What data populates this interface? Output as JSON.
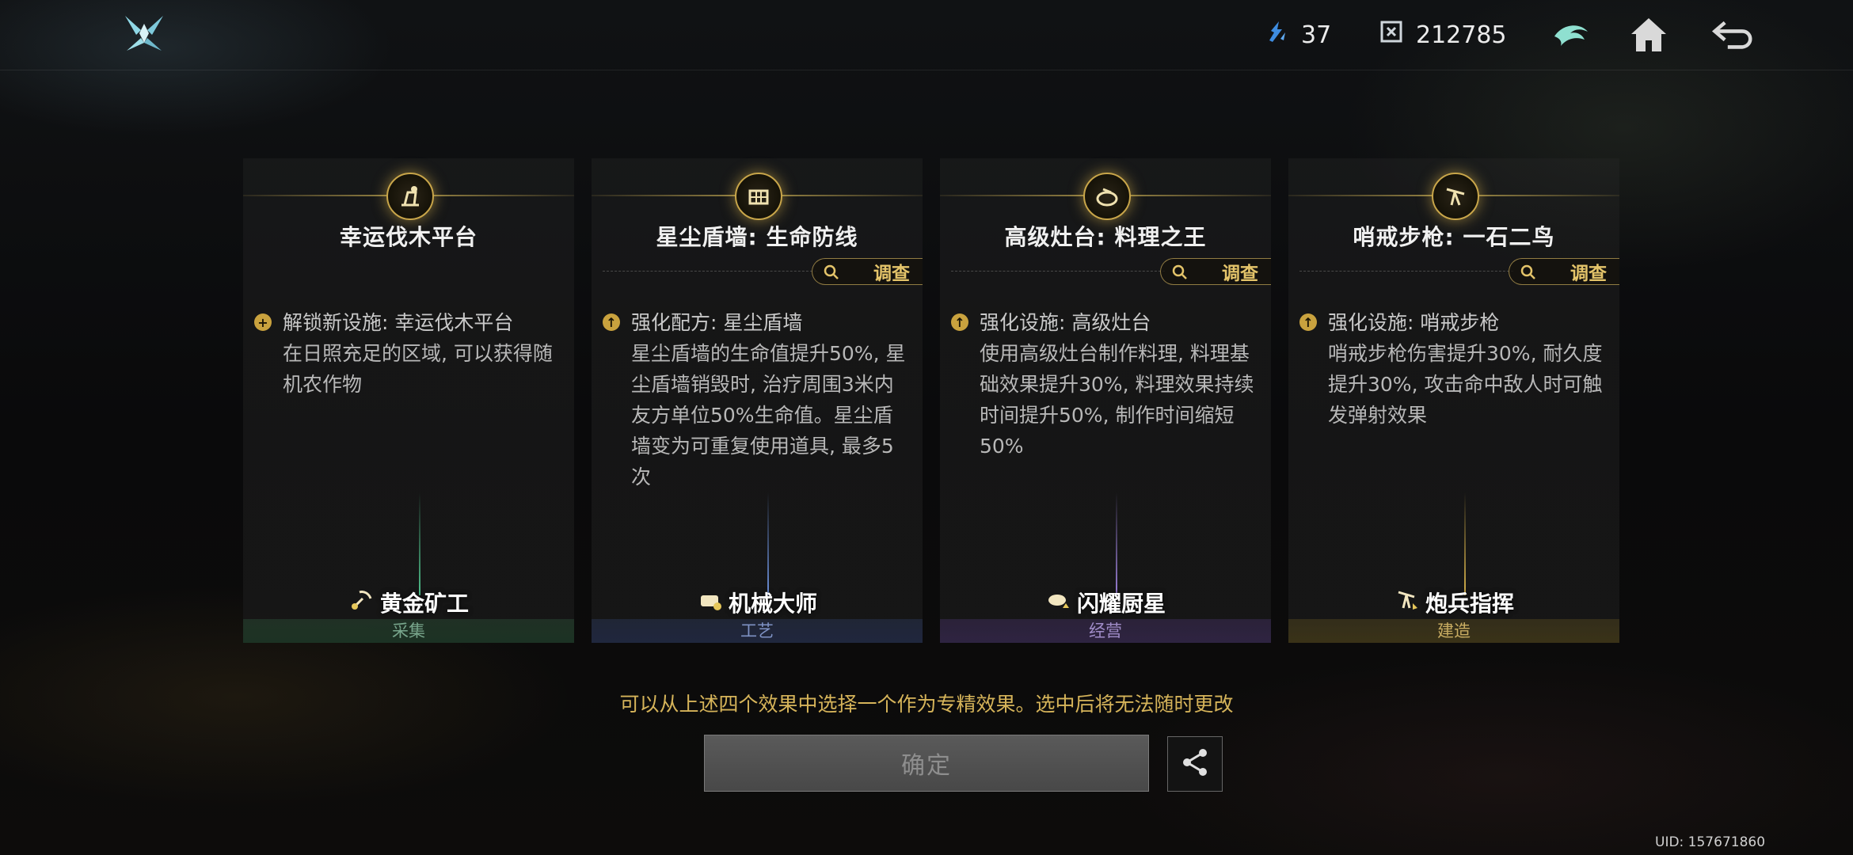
{
  "topbar": {
    "resource_a": {
      "icon": "crystal-shard-icon",
      "value": "37"
    },
    "resource_b": {
      "icon": "currency-cube-icon",
      "value": "212785"
    },
    "icons": [
      "brand-emblem-icon",
      "home-icon",
      "back-icon"
    ]
  },
  "cards": [
    {
      "emblem": "lumber-platform-icon",
      "title": "幸运伐木平台",
      "inspect_label": "",
      "effect_head": "解锁新设施: 幸运伐木平台",
      "effect_body": "在日照充足的区域, 可以获得随机农作物",
      "role": "黄金矿工",
      "role_icon": "miner-icon",
      "category": "采集",
      "accent": "#4fbf8a"
    },
    {
      "emblem": "stardust-wall-icon",
      "title": "星尘盾墙: 生命防线",
      "inspect_label": "调查",
      "effect_head": "强化配方: 星尘盾墙",
      "effect_body": "星尘盾墙的生命值提升50%, 星尘盾墙销毁时, 治疗周围3米内友方单位50%生命值。星尘盾墙变为可重复使用道具, 最多5次",
      "role": "机械大师",
      "role_icon": "mechanic-icon",
      "category": "工艺",
      "accent": "#6b8fd8"
    },
    {
      "emblem": "stove-icon",
      "title": "高级灶台: 料理之王",
      "inspect_label": "调查",
      "effect_head": "强化设施: 高级灶台",
      "effect_body": "使用高级灶台制作料理, 料理基础效果提升30%, 料理效果持续时间提升50%, 制作时间缩短50%",
      "role": "闪耀厨星",
      "role_icon": "chef-icon",
      "category": "经营",
      "accent": "#9a7fd6"
    },
    {
      "emblem": "sentry-rifle-icon",
      "title": "哨戒步枪: 一石二鸟",
      "inspect_label": "调查",
      "effect_head": "强化设施: 哨戒步枪",
      "effect_body": "哨戒步枪伤害提升30%, 耐久度提升30%, 攻击命中敌人时可触发弹射效果",
      "role": "炮兵指挥",
      "role_icon": "artillery-icon",
      "category": "建造",
      "accent": "#d4b04a"
    }
  ],
  "hint": "可以从上述四个效果中选择一个作为专精效果。选中后将无法随时更改",
  "confirm_label": "确定",
  "uid": "UID: 157671860"
}
